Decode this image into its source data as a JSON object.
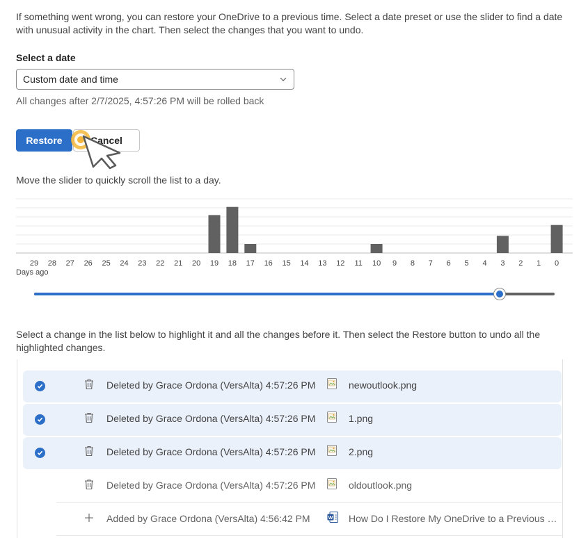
{
  "intro": "If something went wrong, you can restore your OneDrive to a previous time. Select a date preset or use the slider to find a date with unusual activity in the chart. Then select the changes that you want to undo.",
  "date_label": "Select a date",
  "date_select": {
    "value": "Custom date and time"
  },
  "rollback_text": "All changes after 2/7/2025, 4:57:26 PM will be rolled back",
  "buttons": {
    "restore": "Restore",
    "cancel": "Cancel"
  },
  "slider_hint": "Move the slider to quickly scroll the list to a day.",
  "chart_data": {
    "type": "bar",
    "categories": [
      "29",
      "28",
      "27",
      "26",
      "25",
      "24",
      "23",
      "22",
      "21",
      "20",
      "19",
      "18",
      "17",
      "16",
      "15",
      "14",
      "13",
      "12",
      "11",
      "10",
      "9",
      "8",
      "7",
      "6",
      "5",
      "4",
      "3",
      "2",
      "1",
      "0"
    ],
    "values": [
      0,
      0,
      0,
      0,
      0,
      0,
      0,
      0,
      0,
      0,
      4.2,
      5.1,
      1.0,
      0,
      0,
      0,
      0,
      0,
      0,
      1.0,
      0,
      0,
      0,
      0,
      0,
      0,
      1.9,
      0,
      0,
      3.1
    ],
    "xlabel": "Days ago",
    "ylim": [
      0,
      6
    ],
    "grid": true,
    "bar_color": "#616161"
  },
  "slider": {
    "value_fraction": 0.895
  },
  "list_hint": "Select a change in the list below to highlight it and all the changes before it. Then select the Restore button to undo all the highlighted changes.",
  "changes": [
    {
      "selected": true,
      "action_icon": "trash-icon",
      "desc": "Deleted by Grace Ordona (VersAlta) 4:57:26 PM",
      "file_icon": "image-file-icon",
      "file": "newoutlook.png"
    },
    {
      "selected": true,
      "action_icon": "trash-icon",
      "desc": "Deleted by Grace Ordona (VersAlta) 4:57:26 PM",
      "file_icon": "image-file-icon",
      "file": "1.png"
    },
    {
      "selected": true,
      "action_icon": "trash-icon",
      "desc": "Deleted by Grace Ordona (VersAlta) 4:57:26 PM",
      "file_icon": "image-file-icon",
      "file": "2.png"
    },
    {
      "selected": false,
      "action_icon": "trash-icon",
      "desc": "Deleted by Grace Ordona (VersAlta) 4:57:26 PM",
      "file_icon": "image-file-icon",
      "file": "oldoutlook.png"
    },
    {
      "selected": false,
      "action_icon": "plus-icon",
      "desc": "Added by Grace Ordona (VersAlta) 4:56:42 PM",
      "file_icon": "word-file-icon",
      "file": "How Do I Restore My OneDrive to a Previous State"
    }
  ],
  "colors": {
    "accent": "#2b6fc8",
    "selected_row": "#ebf1fb",
    "bar": "#616161"
  }
}
